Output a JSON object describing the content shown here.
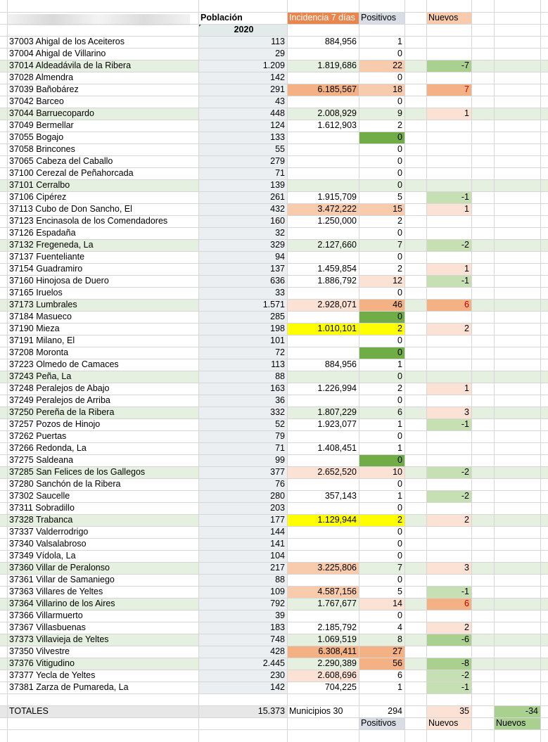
{
  "header": {
    "poblacion": "Población",
    "incidencia": "Incidencia 7 días",
    "positivos": "Positivos",
    "nuevos": "Nuevos",
    "year": "2020"
  },
  "colors": {
    "header_orange": "#e9864e",
    "header_salmon": "#f8cbad",
    "header_grey": "#d9dde5",
    "row_band": "#e6f0e0",
    "heat_light": "#fbe2d5",
    "heat_mid": "#f8cbad",
    "heat_strong": "#f4b183",
    "green_light": "#c6e0b4",
    "green_mid": "#a9d08e",
    "green_zero": "#70ad47",
    "yellow": "#ffff00"
  },
  "rows": [
    {
      "mun": "37003 Ahigal de los Aceiteros",
      "pop": "113",
      "inc": "884,956",
      "pos": "1",
      "nue": ""
    },
    {
      "mun": "37004 Ahigal de Villarino",
      "pop": "29",
      "inc": "",
      "pos": "0",
      "nue": ""
    },
    {
      "mun": "37014 Aldeadávila de la Ribera",
      "pop": "1.209",
      "inc": "1.819,686",
      "pos": "22",
      "nue": "-7"
    },
    {
      "mun": "37028 Almendra",
      "pop": "142",
      "inc": "",
      "pos": "0",
      "nue": ""
    },
    {
      "mun": "37039 Bañobárez",
      "pop": "291",
      "inc": "6.185,567",
      "pos": "18",
      "nue": "7"
    },
    {
      "mun": "37042 Barceo",
      "pop": "43",
      "inc": "",
      "pos": "0",
      "nue": ""
    },
    {
      "mun": "37044 Barruecopardo",
      "pop": "448",
      "inc": "2.008,929",
      "pos": "9",
      "nue": "1"
    },
    {
      "mun": "37049 Bermellar",
      "pop": "124",
      "inc": "1.612,903",
      "pos": "2",
      "nue": ""
    },
    {
      "mun": "37055 Bogajo",
      "pop": "133",
      "inc": "",
      "pos": "0",
      "nue": ""
    },
    {
      "mun": "37058 Brincones",
      "pop": "55",
      "inc": "",
      "pos": "0",
      "nue": ""
    },
    {
      "mun": "37065 Cabeza del Caballo",
      "pop": "279",
      "inc": "",
      "pos": "0",
      "nue": ""
    },
    {
      "mun": "37100 Cerezal de Peñahorcada",
      "pop": "71",
      "inc": "",
      "pos": "0",
      "nue": ""
    },
    {
      "mun": "37101 Cerralbo",
      "pop": "139",
      "inc": "",
      "pos": "0",
      "nue": ""
    },
    {
      "mun": "37106 Cipérez",
      "pop": "261",
      "inc": "1.915,709",
      "pos": "5",
      "nue": "-1"
    },
    {
      "mun": "37113 Cubo de Don Sancho, El",
      "pop": "432",
      "inc": "3.472,222",
      "pos": "15",
      "nue": "1"
    },
    {
      "mun": "37123 Encinasola de los Comendadores",
      "pop": "160",
      "inc": "1.250,000",
      "pos": "2",
      "nue": ""
    },
    {
      "mun": "37126 Espadaña",
      "pop": "32",
      "inc": "",
      "pos": "0",
      "nue": ""
    },
    {
      "mun": "37132 Fregeneda, La",
      "pop": "329",
      "inc": "2.127,660",
      "pos": "7",
      "nue": "-2"
    },
    {
      "mun": "37137 Fuenteliante",
      "pop": "94",
      "inc": "",
      "pos": "0",
      "nue": ""
    },
    {
      "mun": "37154 Guadramiro",
      "pop": "137",
      "inc": "1.459,854",
      "pos": "2",
      "nue": "1"
    },
    {
      "mun": "37160 Hinojosa de Duero",
      "pop": "636",
      "inc": "1.886,792",
      "pos": "12",
      "nue": "-1"
    },
    {
      "mun": "37165 Iruelos",
      "pop": "33",
      "inc": "",
      "pos": "0",
      "nue": ""
    },
    {
      "mun": "37173 Lumbrales",
      "pop": "1.571",
      "inc": "2.928,071",
      "pos": "46",
      "nue": "6"
    },
    {
      "mun": "37184 Masueco",
      "pop": "285",
      "inc": "",
      "pos": "0",
      "nue": ""
    },
    {
      "mun": "37190 Mieza",
      "pop": "198",
      "inc": "1.010,101",
      "pos": "2",
      "nue": "2"
    },
    {
      "mun": "37191 Milano, El",
      "pop": "101",
      "inc": "",
      "pos": "0",
      "nue": ""
    },
    {
      "mun": "37208 Moronta",
      "pop": "72",
      "inc": "",
      "pos": "0",
      "nue": ""
    },
    {
      "mun": "37223 Olmedo de Camaces",
      "pop": "113",
      "inc": "884,956",
      "pos": "1",
      "nue": ""
    },
    {
      "mun": "37243 Peña, La",
      "pop": "88",
      "inc": "",
      "pos": "0",
      "nue": ""
    },
    {
      "mun": "37248 Peralejos de Abajo",
      "pop": "163",
      "inc": "1.226,994",
      "pos": "2",
      "nue": "1"
    },
    {
      "mun": "37249 Peralejos de Arriba",
      "pop": "36",
      "inc": "",
      "pos": "0",
      "nue": ""
    },
    {
      "mun": "37250 Pereña de la Ribera",
      "pop": "332",
      "inc": "1.807,229",
      "pos": "6",
      "nue": "3"
    },
    {
      "mun": "37257 Pozos de Hinojo",
      "pop": "52",
      "inc": "1.923,077",
      "pos": "1",
      "nue": "-1"
    },
    {
      "mun": "37262 Puertas",
      "pop": "79",
      "inc": "",
      "pos": "0",
      "nue": ""
    },
    {
      "mun": "37266 Redonda, La",
      "pop": "71",
      "inc": "1.408,451",
      "pos": "1",
      "nue": ""
    },
    {
      "mun": "37275 Saldeana",
      "pop": "99",
      "inc": "",
      "pos": "0",
      "nue": ""
    },
    {
      "mun": "37285 San Felices de los Gallegos",
      "pop": "377",
      "inc": "2.652,520",
      "pos": "10",
      "nue": "-2"
    },
    {
      "mun": "37280 Sanchón de la Ribera",
      "pop": "76",
      "inc": "",
      "pos": "0",
      "nue": ""
    },
    {
      "mun": "37302 Saucelle",
      "pop": "280",
      "inc": "357,143",
      "pos": "1",
      "nue": "-2"
    },
    {
      "mun": "37311 Sobradillo",
      "pop": "203",
      "inc": "",
      "pos": "0",
      "nue": ""
    },
    {
      "mun": "37328 Trabanca",
      "pop": "177",
      "inc": "1.129,944",
      "pos": "2",
      "nue": "2"
    },
    {
      "mun": "37337 Valderrodrigo",
      "pop": "144",
      "inc": "",
      "pos": "0",
      "nue": ""
    },
    {
      "mun": "37340 Valsalabroso",
      "pop": "141",
      "inc": "",
      "pos": "0",
      "nue": ""
    },
    {
      "mun": "37349 Vídola, La",
      "pop": "104",
      "inc": "",
      "pos": "0",
      "nue": ""
    },
    {
      "mun": "37360 Villar de Peralonso",
      "pop": "217",
      "inc": "3.225,806",
      "pos": "7",
      "nue": "3"
    },
    {
      "mun": "37361 Villar de Samaniego",
      "pop": "88",
      "inc": "",
      "pos": "0",
      "nue": ""
    },
    {
      "mun": "37363 Villares de Yeltes",
      "pop": "109",
      "inc": "4.587,156",
      "pos": "5",
      "nue": "-1"
    },
    {
      "mun": "37364 Villarino de los Aires",
      "pop": "792",
      "inc": "1.767,677",
      "pos": "14",
      "nue": "6"
    },
    {
      "mun": "37366 Villarmuerto",
      "pop": "39",
      "inc": "",
      "pos": "0",
      "nue": ""
    },
    {
      "mun": "37367 Villasbuenas",
      "pop": "183",
      "inc": "2.185,792",
      "pos": "4",
      "nue": "2"
    },
    {
      "mun": "37373 Villavieja de Yeltes",
      "pop": "748",
      "inc": "1.069,519",
      "pos": "8",
      "nue": "-6"
    },
    {
      "mun": "37350 Vilvestre",
      "pop": "428",
      "inc": "6.308,411",
      "pos": "27",
      "nue": ""
    },
    {
      "mun": "37376 Vitigudino",
      "pop": "2.445",
      "inc": "2.290,389",
      "pos": "56",
      "nue": "-8"
    },
    {
      "mun": "37377 Yecla de Yeltes",
      "pop": "230",
      "inc": "2.608,696",
      "pos": "6",
      "nue": "-2"
    },
    {
      "mun": "37381 Zarza de Pumareda, La",
      "pop": "142",
      "inc": "704,225",
      "pos": "1",
      "nue": "-1"
    }
  ],
  "totals": {
    "label": "TOTALES",
    "pop": "15.373",
    "municipios": "Municipios 30",
    "pos": "294",
    "nue": "35",
    "nue2": "-34",
    "foot_positivos": "Positivos",
    "foot_nuevos": "Nuevos",
    "foot_nuevos2": "Nuevos"
  }
}
